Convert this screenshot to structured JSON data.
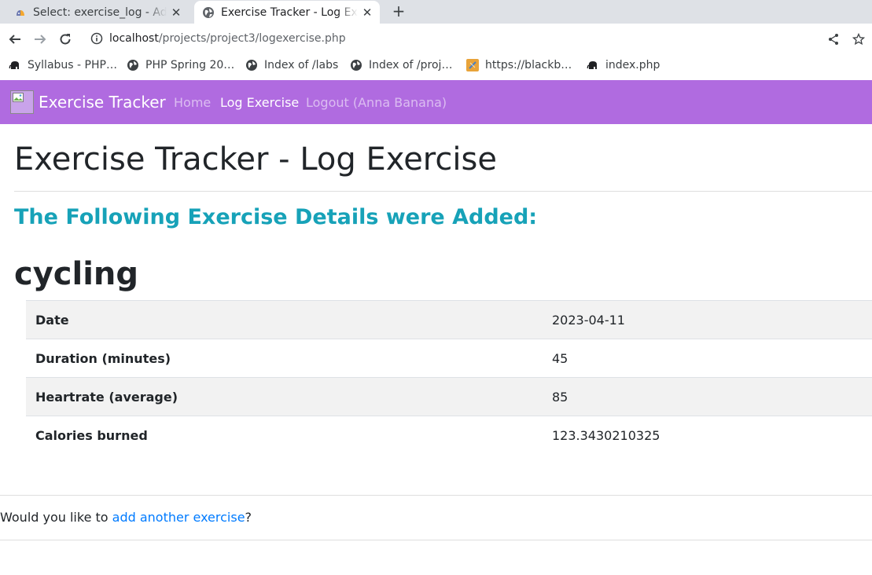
{
  "browser": {
    "tabs": [
      {
        "title": "Select: exercise_log - Adm",
        "active": false,
        "icon": "phpmyadmin-icon"
      },
      {
        "title": "Exercise Tracker - Log Exer",
        "active": true,
        "icon": "globe-icon"
      }
    ],
    "new_tab_label": "+",
    "close_glyph": "✕",
    "url_host": "localhost",
    "url_path": "/projects/project3/logexercise.php",
    "bookmarks": [
      {
        "label": "Syllabus - PHP…",
        "icon": "php-elephant-icon"
      },
      {
        "label": "PHP Spring 20…",
        "icon": "globe-icon"
      },
      {
        "label": "Index of /labs",
        "icon": "globe-icon"
      },
      {
        "label": "Index of /proj…",
        "icon": "globe-icon"
      },
      {
        "label": "https://blackb…",
        "icon": "blackboard-icon"
      },
      {
        "label": "index.php",
        "icon": "php-elephant-icon"
      }
    ]
  },
  "navbar": {
    "brand": "Exercise Tracker",
    "links": [
      {
        "label": "Home",
        "active": false
      },
      {
        "label": "Log Exercise",
        "active": true
      },
      {
        "label": "Logout (Anna Banana)",
        "active": false
      }
    ],
    "bg_color": "#b06be0"
  },
  "page": {
    "title": "Exercise Tracker - Log Exercise",
    "subtitle": "The Following Exercise Details were Added:",
    "exercise_type": "cycling",
    "details": [
      {
        "label": "Date",
        "value": "2023-04-11"
      },
      {
        "label": "Duration (minutes)",
        "value": "45"
      },
      {
        "label": "Heartrate (average)",
        "value": "85"
      },
      {
        "label": "Calories burned",
        "value": "123.3430210325"
      }
    ],
    "footer_prefix": "Would you like to ",
    "footer_link": "add another exercise",
    "footer_suffix": "?",
    "accent_color": "#17a2b8",
    "link_color": "#007bff"
  }
}
